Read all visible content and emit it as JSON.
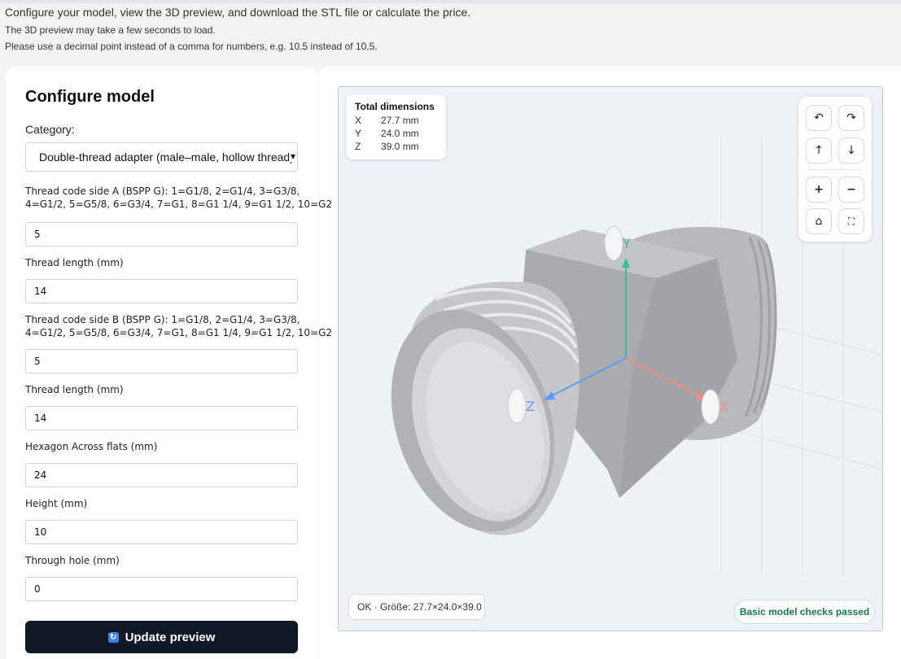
{
  "intro": {
    "line1": "Configure your model, view the 3D preview, and download the STL file or calculate the price.",
    "line2": "The 3D preview may take a few seconds to load.",
    "line3": "Please use a decimal point instead of a comma for numbers, e.g. 10.5 instead of 10,5."
  },
  "config": {
    "title": "Configure model",
    "category_label": "Category:",
    "category_value": "Double-thread adapter (male–male, hollow thread)",
    "fields": [
      {
        "label_line1": "Thread code side A (BSPP G): 1=G1/8, 2=G1/4, 3=G3/8,",
        "label_line2": "4=G1/2, 5=G5/8, 6=G3/4, 7=G1, 8=G1 1/4, 9=G1 1/2, 10=G2",
        "value": "5"
      },
      {
        "label_line1": "Thread length (mm)",
        "value": "14"
      },
      {
        "label_line1": "Thread code side B (BSPP G): 1=G1/8, 2=G1/4, 3=G3/8,",
        "label_line2": "4=G1/2, 5=G5/8, 6=G3/4, 7=G1, 8=G1 1/4, 9=G1 1/2, 10=G2",
        "value": "5"
      },
      {
        "label_line1": "Thread length (mm)",
        "value": "14"
      },
      {
        "label_line1": "Hexagon Across flats (mm)",
        "value": "24"
      },
      {
        "label_line1": "Height (mm)",
        "value": "10"
      },
      {
        "label_line1": "Through hole (mm)",
        "value": "0"
      }
    ],
    "update_button": "Update preview"
  },
  "viewer": {
    "dims_title": "Total dimensions",
    "dims": [
      {
        "axis": "X",
        "value": "27.7 mm"
      },
      {
        "axis": "Y",
        "value": "24.0 mm"
      },
      {
        "axis": "Z",
        "value": "39.0 mm"
      }
    ],
    "axis_labels": {
      "x": "X",
      "y": "Y",
      "z": "Z"
    },
    "status_text": "OK · Größe: 27.7×24.0×39.0",
    "checks_text": "Basic model checks passed",
    "controls": {
      "rotate_left": "↶",
      "rotate_right": "↷",
      "up": "↑",
      "down": "↓",
      "zoom_in": "+",
      "zoom_out": "−",
      "home": "⌂",
      "fullscreen": "⛶"
    },
    "colors": {
      "x_axis": "#f28b82",
      "y_axis": "#34c38f",
      "z_axis": "#5b9cf5",
      "model": "#b5b7ba"
    }
  }
}
